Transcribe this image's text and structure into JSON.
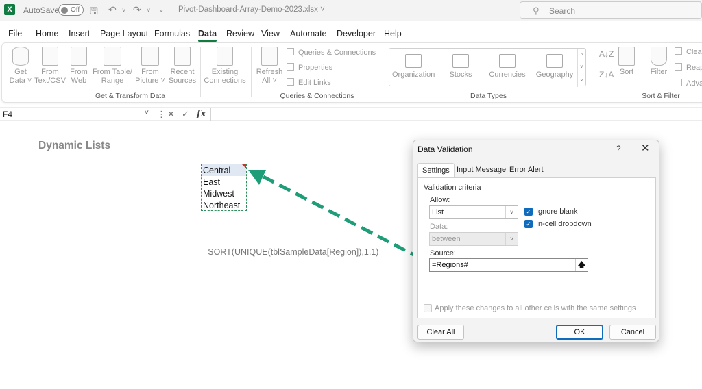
{
  "titlebar": {
    "autosave_label": "AutoSave",
    "autosave_state": "Off",
    "filename": "Pivot-Dashboard-Array-Demo-2023.xlsx",
    "search_placeholder": "Search"
  },
  "menu": [
    "File",
    "Home",
    "Insert",
    "Page Layout",
    "Formulas",
    "Data",
    "Review",
    "View",
    "Automate",
    "Developer",
    "Help"
  ],
  "active_menu": "Data",
  "ribbon": {
    "get_transform": {
      "buttons": [
        {
          "l1": "Get",
          "l2": "Data ˅"
        },
        {
          "l1": "From",
          "l2": "Text/CSV"
        },
        {
          "l1": "From",
          "l2": "Web"
        },
        {
          "l1": "From Table/",
          "l2": "Range"
        },
        {
          "l1": "From",
          "l2": "Picture ˅"
        },
        {
          "l1": "Recent",
          "l2": "Sources"
        },
        {
          "l1": "Existing",
          "l2": "Connections"
        }
      ],
      "label": "Get & Transform Data"
    },
    "queries": {
      "refresh_l1": "Refresh",
      "refresh_l2": "All ˅",
      "items": [
        "Queries & Connections",
        "Properties",
        "Edit Links"
      ],
      "label": "Queries & Connections"
    },
    "data_types": {
      "items": [
        "Organization",
        "Stocks",
        "Currencies",
        "Geography"
      ],
      "label": "Data Types"
    },
    "sort_filter": {
      "sort": "Sort",
      "filter": "Filter",
      "clear": "Clear",
      "reapply": "Reap",
      "advanced": "Adva",
      "label": "Sort & Filter"
    }
  },
  "formula_bar": {
    "name_box": "F4",
    "fx": "fx",
    "formula": ""
  },
  "sheet": {
    "title": "Dynamic Lists",
    "regions": [
      "Central",
      "East",
      "Midwest",
      "Northeast"
    ],
    "formula_text": "=SORT(UNIQUE(tblSampleData[Region]),1,1)"
  },
  "colors": {
    "excel_green": "#107c41",
    "arrow_green": "#1e9e78",
    "primary_blue": "#0f6cbd"
  },
  "dialog": {
    "title": "Data Validation",
    "help": "?",
    "close": "✕",
    "tabs": [
      "Settings",
      "Input Message",
      "Error Alert"
    ],
    "active_tab": "Settings",
    "criteria_label": "Validation criteria",
    "allow_label": "Allow:",
    "allow_value": "List",
    "data_label": "Data:",
    "data_value": "between",
    "ignore_blank": "Ignore blank",
    "incell_dropdown": "In-cell dropdown",
    "source_label": "Source:",
    "source_value": "=Regions#",
    "apply_all": "Apply these changes to all other cells with the same settings",
    "clear_all": "Clear All",
    "ok": "OK",
    "cancel": "Cancel"
  }
}
